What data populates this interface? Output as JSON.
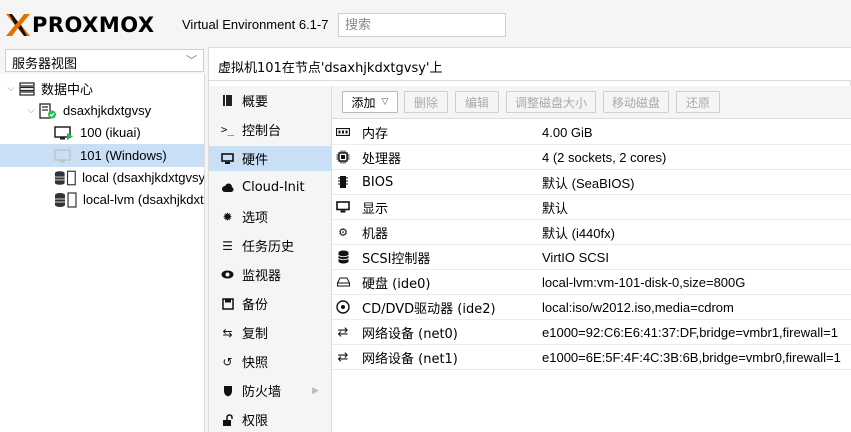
{
  "header": {
    "brand": "PROXMOX",
    "version": "Virtual Environment 6.1-7",
    "search_placeholder": "搜索"
  },
  "view_selector": {
    "value": "服务器视图"
  },
  "tree": {
    "datacenter": "数据中心",
    "node": "dsaxhjkdxtgvsy",
    "items": [
      {
        "label": "100 (ikuai)"
      },
      {
        "label": "101 (Windows)"
      },
      {
        "label": "local (dsaxhjkdxtgvsy"
      },
      {
        "label": "local-lvm (dsaxhjkdxt"
      }
    ]
  },
  "breadcrumb": "虚拟机101在节点'dsaxhjkdxtgvsy'上",
  "nav": [
    {
      "label": "概要",
      "icon": "book-icon"
    },
    {
      "label": "控制台",
      "icon": "terminal-icon"
    },
    {
      "label": "硬件",
      "icon": "desktop-icon"
    },
    {
      "label": "Cloud-Init",
      "icon": "cloud-icon"
    },
    {
      "label": "选项",
      "icon": "gear-icon"
    },
    {
      "label": "任务历史",
      "icon": "list-icon"
    },
    {
      "label": "监视器",
      "icon": "eye-icon"
    },
    {
      "label": "备份",
      "icon": "floppy-icon"
    },
    {
      "label": "复制",
      "icon": "retweet-icon"
    },
    {
      "label": "快照",
      "icon": "history-icon"
    },
    {
      "label": "防火墙",
      "icon": "shield-icon"
    },
    {
      "label": "权限",
      "icon": "unlock-icon"
    }
  ],
  "toolbar": {
    "add": "添加",
    "remove": "删除",
    "edit": "编辑",
    "resize": "调整磁盘大小",
    "move": "移动磁盘",
    "revert": "还原"
  },
  "hardware": [
    {
      "name": "内存",
      "value": "4.00 GiB",
      "icon": "memory-icon"
    },
    {
      "name": "处理器",
      "value": "4 (2 sockets, 2 cores)",
      "icon": "cpu-icon"
    },
    {
      "name": "BIOS",
      "value": "默认 (SeaBIOS)",
      "icon": "microchip-icon"
    },
    {
      "name": "显示",
      "value": "默认",
      "icon": "desktop-icon"
    },
    {
      "name": "机器",
      "value": "默认 (i440fx)",
      "icon": "cogs-icon"
    },
    {
      "name": "SCSI控制器",
      "value": "VirtIO SCSI",
      "icon": "database-icon"
    },
    {
      "name": "硬盘 (ide0)",
      "value": "local-lvm:vm-101-disk-0,size=800G",
      "icon": "hdd-icon"
    },
    {
      "name": "CD/DVD驱动器 (ide2)",
      "value": "local:iso/w2012.iso,media=cdrom",
      "icon": "cdrom-icon"
    },
    {
      "name": "网络设备 (net0)",
      "value": "e1000=92:C6:E6:41:37:DF,bridge=vmbr1,firewall=1",
      "icon": "exchange-icon"
    },
    {
      "name": "网络设备 (net1)",
      "value": "e1000=6E:5F:4F:4C:3B:6B,bridge=vmbr0,firewall=1",
      "icon": "exchange-icon"
    }
  ],
  "colors": {
    "brand_orange": "#e57000",
    "selection": "#c9dff5",
    "status_green": "#21bf4b"
  }
}
